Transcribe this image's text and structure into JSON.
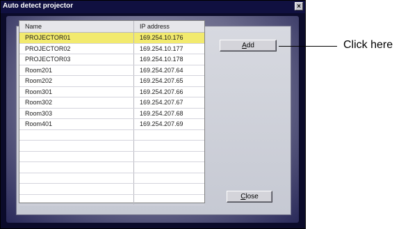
{
  "window": {
    "title": "Auto detect projector",
    "close_glyph": "×"
  },
  "list": {
    "columns": [
      "Name",
      "IP address"
    ],
    "rows": [
      {
        "name": "PROJECTOR01",
        "ip": "169.254.10.176",
        "selected": true
      },
      {
        "name": "PROJECTOR02",
        "ip": "169.254.10.177"
      },
      {
        "name": "PROJECTOR03",
        "ip": "169.254.10.178"
      },
      {
        "name": "Room201",
        "ip": "169.254.207.64"
      },
      {
        "name": "Room202",
        "ip": "169.254.207.65"
      },
      {
        "name": "Room301",
        "ip": "169.254.207.66"
      },
      {
        "name": "Room302",
        "ip": "169.254.207.67"
      },
      {
        "name": "Room303",
        "ip": "169.254.207.68"
      },
      {
        "name": "Room401",
        "ip": "169.254.207.69"
      },
      {
        "name": "",
        "ip": ""
      },
      {
        "name": "",
        "ip": ""
      },
      {
        "name": "",
        "ip": ""
      },
      {
        "name": "",
        "ip": ""
      },
      {
        "name": "",
        "ip": ""
      },
      {
        "name": "",
        "ip": ""
      },
      {
        "name": "",
        "ip": ""
      }
    ]
  },
  "buttons": {
    "add": "Add",
    "close": "Close"
  },
  "callout": {
    "text": "Click here"
  },
  "colors": {
    "selected_row": "#f2ea6e",
    "window_bg": "#0b0b2a"
  }
}
